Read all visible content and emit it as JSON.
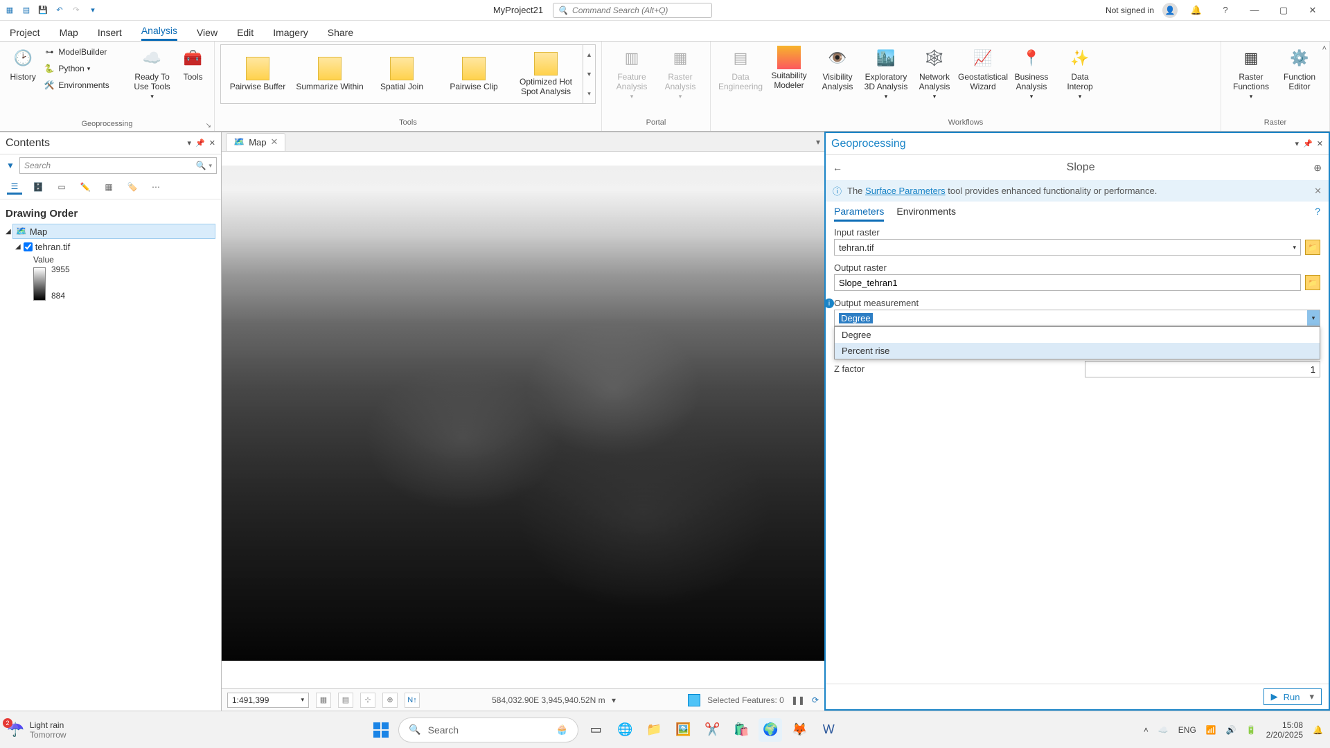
{
  "titlebar": {
    "project": "MyProject21",
    "search_placeholder": "Command Search (Alt+Q)",
    "signin": "Not signed in"
  },
  "ribbon_tabs": [
    "Project",
    "Map",
    "Insert",
    "Analysis",
    "View",
    "Edit",
    "Imagery",
    "Share"
  ],
  "ribbon_active_tab": "Analysis",
  "ribbon": {
    "geoprocessing": {
      "label": "Geoprocessing",
      "history": "History",
      "modelbuilder": "ModelBuilder",
      "python": "Python",
      "environments": "Environments",
      "ready": "Ready To Use Tools",
      "tools": "Tools"
    },
    "tools": {
      "label": "Tools",
      "gallery": [
        "Pairwise Buffer",
        "Summarize Within",
        "Spatial Join",
        "Pairwise Clip",
        "Optimized Hot Spot Analysis"
      ]
    },
    "portal": {
      "label": "Portal",
      "feature": "Feature Analysis",
      "raster": "Raster Analysis"
    },
    "workflows": {
      "label": "Workflows",
      "items": [
        "Data Engineering",
        "Suitability Modeler",
        "Visibility Analysis",
        "Exploratory 3D Analysis",
        "Network Analysis",
        "Geostatistical Wizard",
        "Business Analysis",
        "Data Interop"
      ]
    },
    "raster": {
      "label": "Raster",
      "functions": "Raster Functions",
      "editor": "Function Editor"
    }
  },
  "contents": {
    "title": "Contents",
    "search_placeholder": "Search",
    "section": "Drawing Order",
    "map_name": "Map",
    "layer": "tehran.tif",
    "value_label": "Value",
    "value_max": "3955",
    "value_min": "884"
  },
  "maptab": {
    "name": "Map"
  },
  "mapstatus": {
    "scale": "1:491,399",
    "coords": "584,032.90E 3,945,940.52N m",
    "selected": "Selected Features: 0"
  },
  "gp": {
    "title": "Geoprocessing",
    "tool": "Slope",
    "info_pre": "The ",
    "info_link": "Surface Parameters",
    "info_post": " tool provides enhanced functionality or performance.",
    "tab_params": "Parameters",
    "tab_env": "Environments",
    "input_label": "Input raster",
    "input_value": "tehran.tif",
    "output_label": "Output raster",
    "output_value": "Slope_tehran1",
    "measure_label": "Output measurement",
    "measure_value": "Degree",
    "measure_options": [
      "Degree",
      "Percent rise"
    ],
    "zfactor_label": "Z factor",
    "zfactor_value": "1",
    "run": "Run"
  },
  "taskbar": {
    "weather_badge": "2",
    "weather_line1": "Light rain",
    "weather_line2": "Tomorrow",
    "search": "Search",
    "lang": "ENG",
    "time": "15:08",
    "date": "2/20/2025"
  }
}
